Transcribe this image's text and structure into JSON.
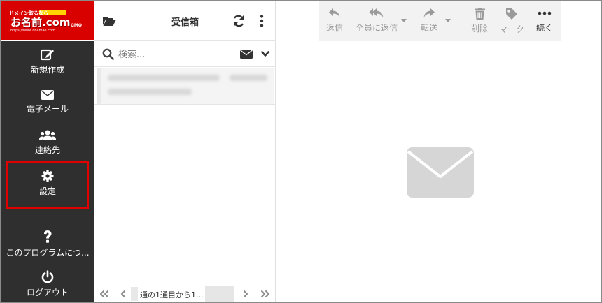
{
  "logo": {
    "tagline": "ドメイン取るなら",
    "badge": "",
    "brand": "お名前.com",
    "gmo": "GMO",
    "url": "https://www.onamae.com"
  },
  "sidebar": {
    "items": [
      {
        "label": "新規作成",
        "icon": "compose-icon"
      },
      {
        "label": "電子メール",
        "icon": "envelope-icon"
      },
      {
        "label": "連絡先",
        "icon": "contacts-icon"
      },
      {
        "label": "設定",
        "icon": "gear-icon",
        "highlighted": true
      },
      {
        "label": "このプログラムにつ...",
        "icon": "question-icon"
      },
      {
        "label": "ログアウト",
        "icon": "power-icon"
      }
    ]
  },
  "mail_list": {
    "folder_title": "受信箱",
    "search_placeholder": "検索...",
    "pager_text": "通の1通目から1..."
  },
  "toolbar": {
    "reply": "返信",
    "reply_all": "全員に返信",
    "forward": "転送",
    "delete": "削除",
    "mark": "マーク",
    "more": "続く"
  },
  "colors": {
    "sidebar_bg": "#2f2f2f",
    "brand_red": "#d90000",
    "highlight": "#e10000"
  }
}
